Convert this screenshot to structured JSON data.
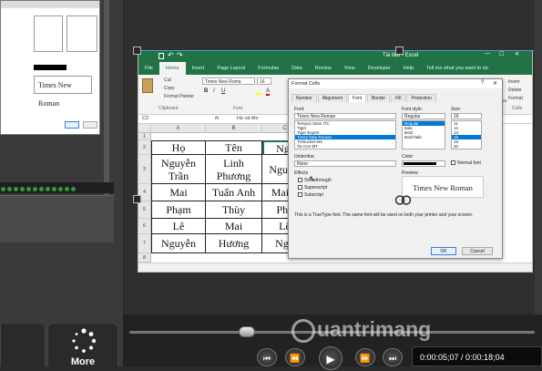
{
  "left": {
    "preview_font": "Times New Roman",
    "more_label": "More",
    "ok": "OK",
    "cancel": "Cancel"
  },
  "excel": {
    "title": "Tài liệu - Excel",
    "tabs": [
      "File",
      "Home",
      "Insert",
      "Page Layout",
      "Formulas",
      "Data",
      "Review",
      "View",
      "Developer",
      "Help",
      "Tell me what you want to do"
    ],
    "active_tab": "Home",
    "ribbon": {
      "cut": "Cut",
      "copy": "Copy",
      "format_painter": "Format Painter",
      "clipboard": "Clipboard",
      "font_name": "Times New Roma",
      "font_size": "16",
      "bold": "B",
      "italic": "I",
      "underline": "U",
      "font_group": "Font",
      "cell_styles": "Cell Styles",
      "insert": "Insert",
      "delete": "Delete",
      "format": "Format",
      "cells": "Cells"
    },
    "name_box": "C2",
    "formula": "Họ và tên",
    "columns": [
      "A",
      "B",
      "C"
    ],
    "rows": [
      "1",
      "2",
      "3",
      "4",
      "5",
      "6",
      "7",
      "8",
      "9"
    ],
    "table": [
      [
        "Họ",
        "Tên",
        "Ngu"
      ],
      [
        "Nguyễn Trần",
        "Linh Phương",
        "Ngu Tr"
      ],
      [
        "Mai",
        "Tuấn Anh",
        "Mai T"
      ],
      [
        "Phạm",
        "Thùy",
        "Phạ"
      ],
      [
        "Lê",
        "Mai",
        "Lê"
      ],
      [
        "Nguyễn",
        "Hương",
        "Ngu"
      ]
    ]
  },
  "dialog": {
    "title": "Format Cells",
    "help": "?",
    "close": "✕",
    "tabs": [
      "Number",
      "Alignment",
      "Font",
      "Border",
      "Fill",
      "Protection"
    ],
    "active_tab": "Font",
    "font_label": "Font:",
    "font_value": "Times New Roman",
    "font_list": [
      "Tempus Sans ITC",
      "Tiger",
      "Tiger Expert",
      "Times New Roman",
      "Trebuchet MS",
      "Tw Cen MT"
    ],
    "font_selected": "Times New Roman",
    "style_label": "Font style:",
    "style_value": "Regular",
    "style_list": [
      "Regular",
      "Italic",
      "Bold",
      "Bold Italic"
    ],
    "size_label": "Size:",
    "size_value": "16",
    "size_list": [
      "11",
      "12",
      "14",
      "16",
      "18",
      "20"
    ],
    "underline_label": "Underline:",
    "underline_value": "None",
    "color_label": "Color:",
    "normal_font": "Normal font",
    "effects_label": "Effects",
    "effects": [
      "Strikethrough",
      "Superscript",
      "Subscript"
    ],
    "preview_label": "Preview",
    "preview_text": "Times New Roman",
    "info": "This is a TrueType font. The same font will be used on both your printer and your screen.",
    "ok": "OK",
    "cancel": "Cancel"
  },
  "player": {
    "time": "0:00:05;07 / 0:00:18;04"
  },
  "watermark": {
    "text": "uantrimang"
  },
  "colors": {
    "excel_green": "#217346",
    "selection_blue": "#0078d7"
  }
}
